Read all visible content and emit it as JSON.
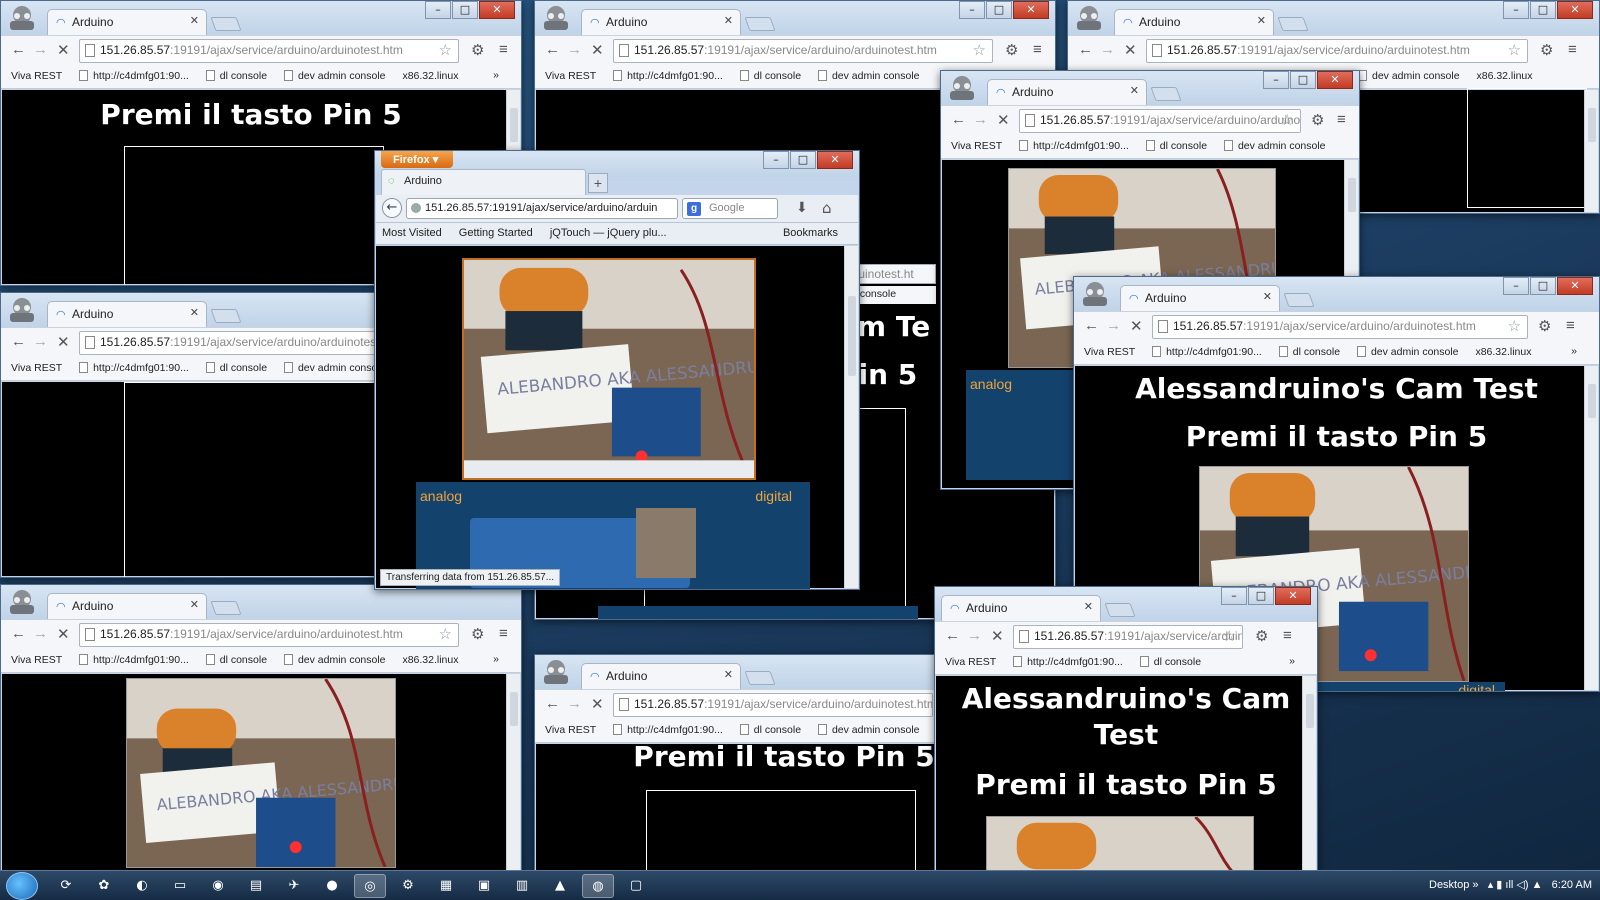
{
  "tab_title": "Arduino",
  "url_host": "151.26.85.57",
  "url_path": ":19191/ajax/service/arduino/arduinotest.htm",
  "ff_url": "151.26.85.57:19191/ajax/service/arduino/arduin",
  "bookmarks": [
    "Viva REST",
    "http://c4dmfg01:90...",
    "dl console",
    "dev admin console",
    "x86.32.linux"
  ],
  "bookmarks_more": "»",
  "page_heading": "Alessandruino's Cam Test",
  "page_heading_wrap": [
    "Alessandruino's Cam",
    "Test"
  ],
  "page_subheading": "Premi il tasto Pin 5",
  "partial_heading": "am Te",
  "partial_subheading": "Pin 5",
  "partial_url": "arduinotest.ht",
  "partial_console": "min console",
  "panel_analog": "analog",
  "panel_digital": "digital",
  "photo_note": "ALEBANDRO AKA ALESSANDRUINO",
  "firefox": {
    "menu": "Firefox",
    "tab": "Arduino",
    "search_placeholder": "Google",
    "bookmarks": [
      "Most Visited",
      "Getting Started",
      "jQTouch — jQuery plu..."
    ],
    "bookmarks_label": "Bookmarks",
    "status": "Transferring data from 151.26.85.57..."
  },
  "window_controls": [
    "–",
    "□",
    "✕"
  ],
  "taskbar": {
    "desktop_label": "Desktop",
    "time": "6:20 AM",
    "apps": [
      "terminal",
      "chrome",
      "firefox",
      "explorer",
      "vlc"
    ]
  },
  "colors": {
    "accent_orange": "#f0a43a",
    "panel_blue": "#13426d",
    "title_bar": "#c3d5ea"
  }
}
